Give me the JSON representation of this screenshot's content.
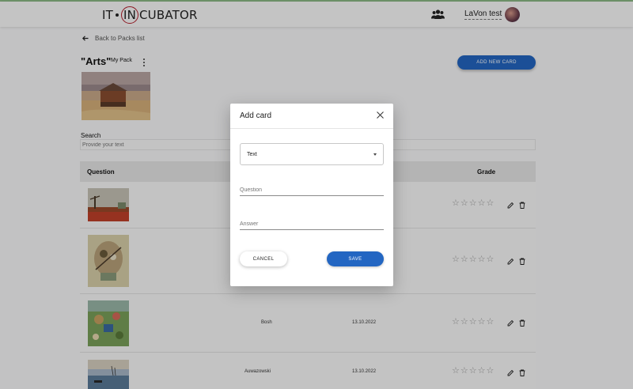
{
  "header": {
    "logo_left": "IT",
    "logo_circle": "IN",
    "logo_right": "CUBATOR",
    "user_name": "LaVon test"
  },
  "pack": {
    "back_label": "Back to Packs list",
    "title": "\"Arts\"",
    "subtitle": "My Pack",
    "add_button": "ADD NEW CARD"
  },
  "search": {
    "label": "Search",
    "placeholder": "Provide your text"
  },
  "table": {
    "headers": {
      "question": "Question",
      "grade": "Grade"
    },
    "rows": [
      {
        "answer": "",
        "updated": "",
        "grade": 0
      },
      {
        "answer": "",
        "updated": "",
        "grade": 0
      },
      {
        "answer": "Bosh",
        "updated": "13.10.2022",
        "grade": 0
      },
      {
        "answer": "Auwazowski",
        "updated": "13.10.2022",
        "grade": 0
      }
    ]
  },
  "modal": {
    "title": "Add card",
    "select_value": "Text",
    "question_placeholder": "Question",
    "answer_placeholder": "Answer",
    "cancel_label": "CANCEL",
    "save_label": "SAVE"
  },
  "colors": {
    "accent": "#2366c2",
    "top_line": "#8dbb86",
    "logo_ring": "#b51c2a"
  }
}
